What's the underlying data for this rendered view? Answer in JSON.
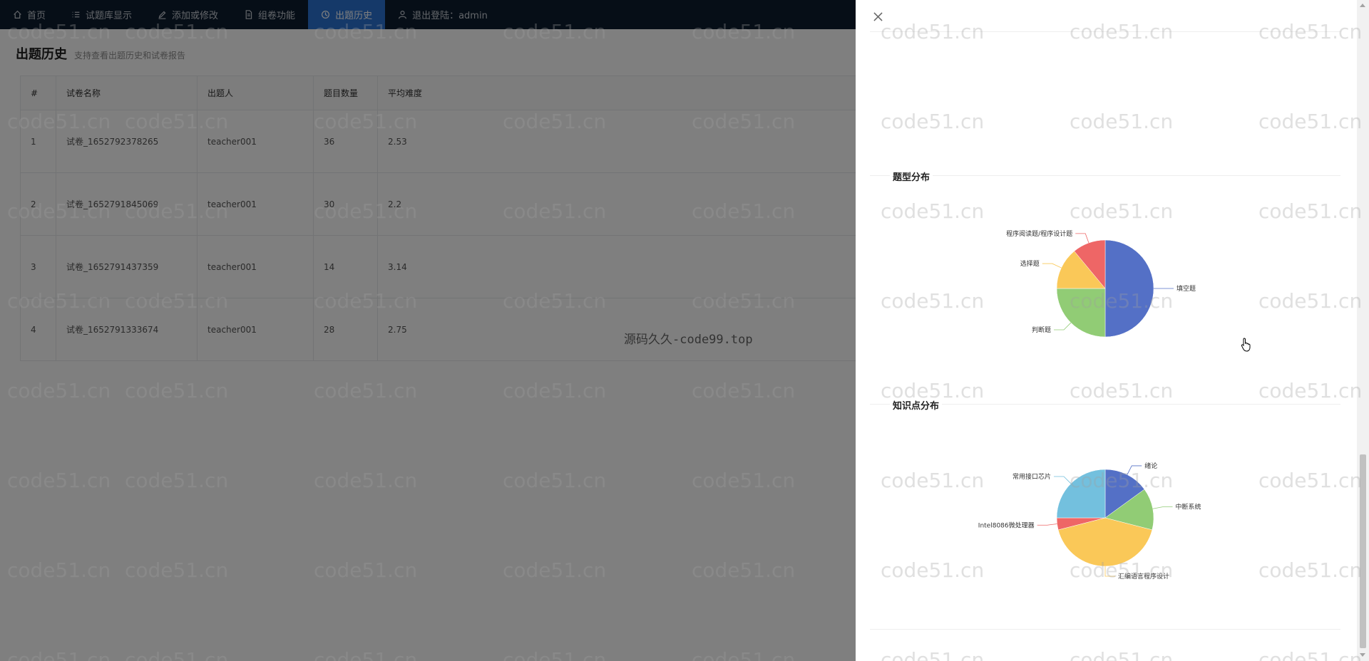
{
  "nav": {
    "items": [
      {
        "label": "首页",
        "icon": "home-icon"
      },
      {
        "label": "试题库显示",
        "icon": "list-icon"
      },
      {
        "label": "添加或修改",
        "icon": "edit-icon"
      },
      {
        "label": "组卷功能",
        "icon": "document-icon"
      },
      {
        "label": "出题历史",
        "icon": "clock-icon",
        "active": true
      },
      {
        "label": "退出登陆：admin",
        "icon": "user-icon"
      }
    ]
  },
  "page": {
    "title": "出题历史",
    "subtitle": "支持查看出题历史和试卷报告"
  },
  "table": {
    "headers": [
      "#",
      "试卷名称",
      "出题人",
      "题目数量",
      "平均难度"
    ],
    "rows": [
      [
        "1",
        "试卷_1652792378265",
        "teacher001",
        "36",
        "2.53"
      ],
      [
        "2",
        "试卷_1652791845069",
        "teacher001",
        "30",
        "2.2"
      ],
      [
        "3",
        "试卷_1652791437359",
        "teacher001",
        "14",
        "3.14"
      ],
      [
        "4",
        "试卷_1652791333674",
        "teacher001",
        "28",
        "2.75"
      ]
    ]
  },
  "credit_text": "源码久久-code99.top",
  "watermark_text": "code51.cn",
  "drawer": {
    "section1_title": "题型分布",
    "section2_title": "知识点分布"
  },
  "chart_data": [
    {
      "type": "pie",
      "title": "题型分布",
      "slices": [
        {
          "label": "填空题",
          "value": 50,
          "color": "#5470c6"
        },
        {
          "label": "判断题",
          "value": 25,
          "color": "#91cc75"
        },
        {
          "label": "选择题",
          "value": 14,
          "color": "#fac858"
        },
        {
          "label": "程序阅读题/程序设计题",
          "value": 11,
          "color": "#ee6666"
        }
      ]
    },
    {
      "type": "pie",
      "title": "知识点分布",
      "slices": [
        {
          "label": "绪论",
          "value": 15,
          "color": "#5470c6"
        },
        {
          "label": "中断系统",
          "value": 14,
          "color": "#91cc75"
        },
        {
          "label": "汇编语言程序设计",
          "value": 42,
          "color": "#fac858"
        },
        {
          "label": "Intel8086微处理器",
          "value": 4,
          "color": "#ee6666"
        },
        {
          "label": "常用接口芯片",
          "value": 25,
          "color": "#73c0de"
        }
      ]
    }
  ]
}
